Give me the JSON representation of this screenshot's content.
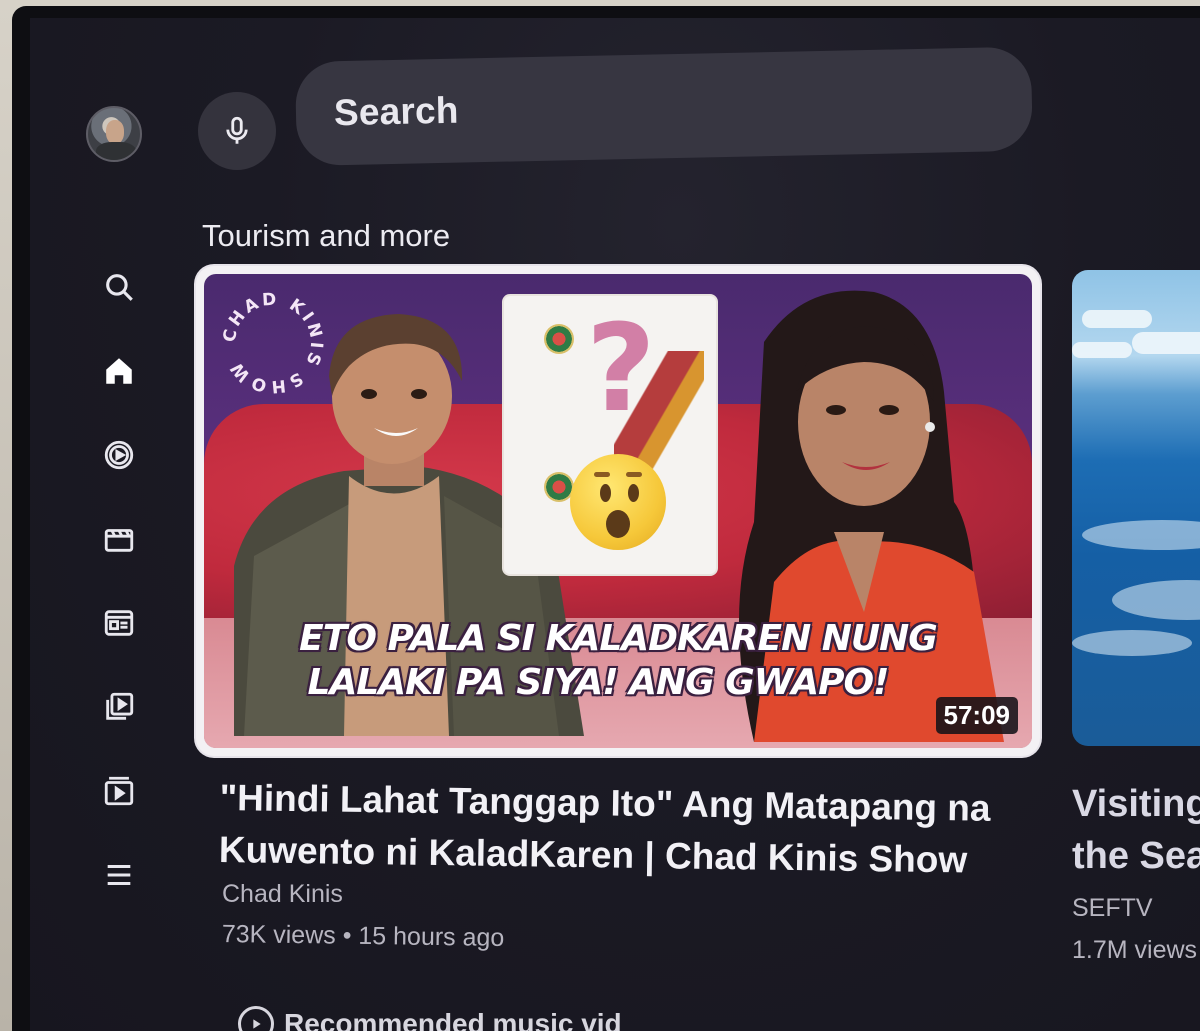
{
  "top_bar": {
    "mic_icon": "mic-icon",
    "search_placeholder": "Search"
  },
  "sidebar": {
    "items": [
      {
        "icon": "search-icon"
      },
      {
        "icon": "home-icon"
      },
      {
        "icon": "shorts-icon"
      },
      {
        "icon": "movies-icon"
      },
      {
        "icon": "subscriptions-icon"
      },
      {
        "icon": "library-icon"
      },
      {
        "icon": "playlist-icon"
      },
      {
        "icon": "menu-icon"
      }
    ]
  },
  "shelf": {
    "title": "Tourism and more",
    "videos": [
      {
        "thumbnail_caption_line1": "ETO PALA SI KALADKAREN NUNG",
        "thumbnail_caption_line2": "LALAKI PA SIYA! ANG GWAPO!",
        "thumbnail_logo_text": "CHAD KINIS SHOW",
        "duration": "57:09",
        "title_line1": "\"Hindi Lahat Tanggap Ito\" Ang Matapang na",
        "title_line2": "Kuwento ni KaladKaren | Chad Kinis Show",
        "channel": "Chad Kinis",
        "meta": "73K views • 15 hours ago"
      },
      {
        "title_line1": "Visiting",
        "title_line2": "the Sea",
        "channel": "SEFTV",
        "meta": "1.7M views"
      }
    ]
  },
  "next_shelf": {
    "title": "Recommended music vid"
  },
  "colors": {
    "background": "#1b1a24",
    "surface": "#373641",
    "text_primary": "#f2f1f6",
    "text_secondary": "#b7b5c0",
    "focus_ring": "#f3f1f4"
  }
}
